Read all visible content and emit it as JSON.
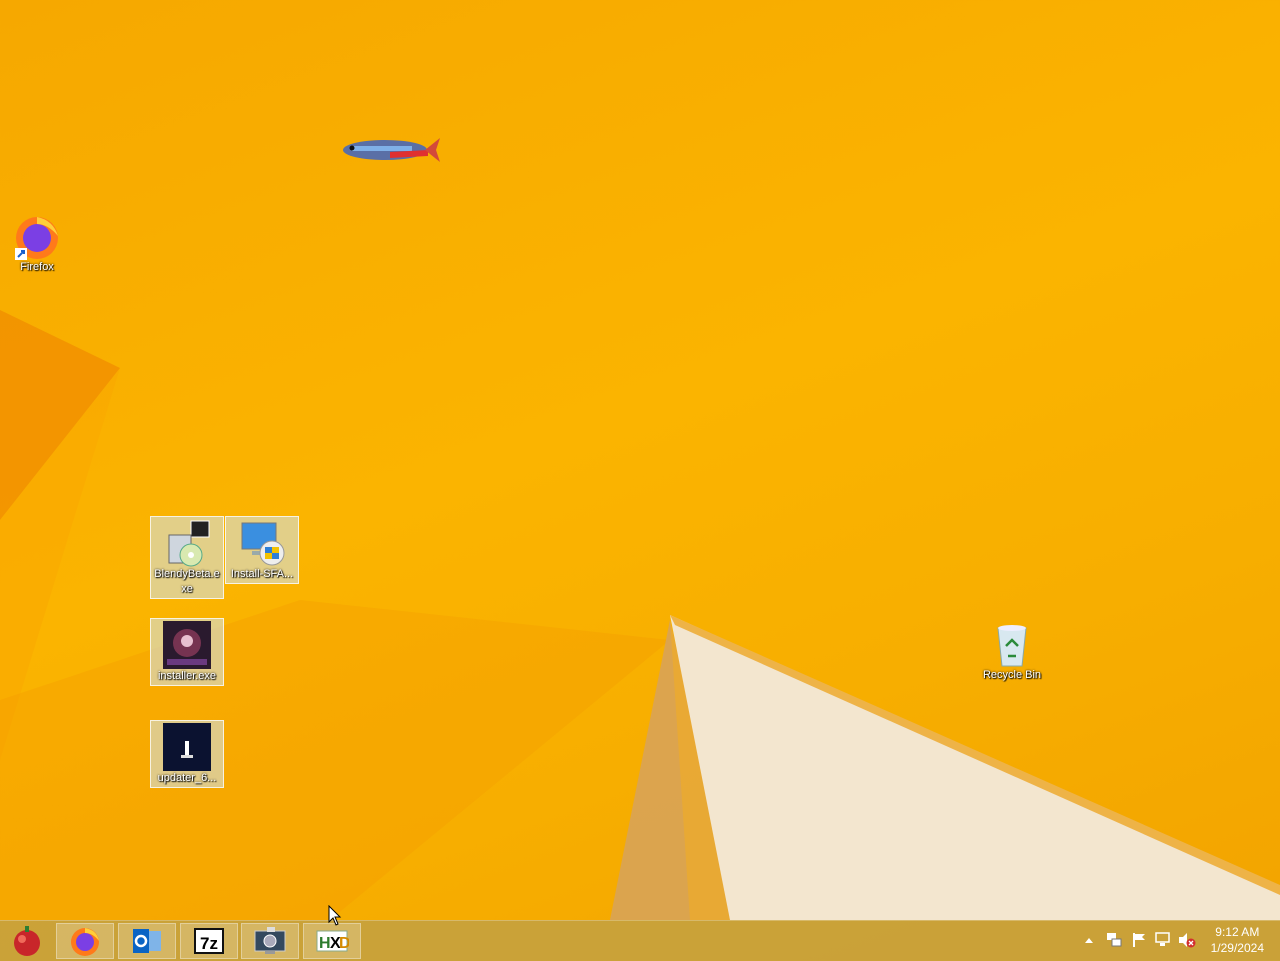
{
  "desktop": {
    "icons": {
      "firefox": "Firefox",
      "blendy": "BlendyBeta.exe",
      "install_sfa": "Install-SFA...",
      "installer": "installer.exe",
      "updater": "updater_6...",
      "recycle": "Recycle Bin"
    }
  },
  "taskbar": {
    "apps": [
      "start-orb-icon",
      "firefox-icon",
      "outlook-icon",
      "7zip-icon",
      "remote-desktop-icon",
      "hex-editor-icon"
    ],
    "clock": {
      "time": "9:12 AM",
      "date": "1/29/2024"
    }
  },
  "tray": [
    "show-hidden-icons-arrow",
    "network-share-icon",
    "action-center-flag-icon",
    "network-icon",
    "volume-muted-icon"
  ]
}
